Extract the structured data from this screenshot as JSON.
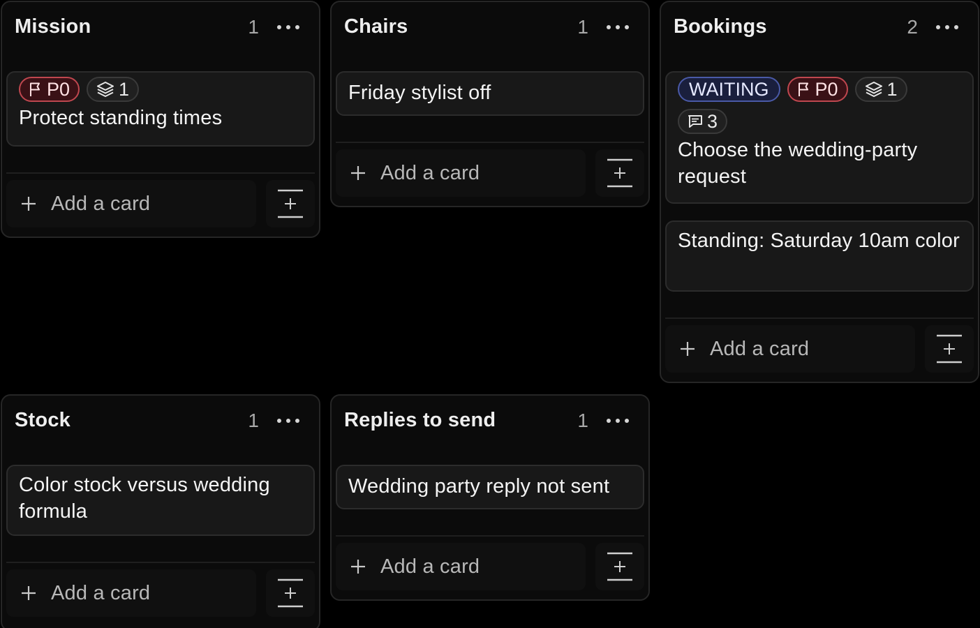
{
  "columns": [
    {
      "title": "Mission",
      "count": "1",
      "cards": [
        {
          "chips": [
            {
              "kind": "priority",
              "icon": "flag-icon",
              "text": "P0"
            },
            {
              "kind": "subtasks",
              "icon": "layers-icon",
              "text": "1"
            }
          ],
          "title": "Protect standing times"
        }
      ],
      "add_label": "Add a card"
    },
    {
      "title": "Chairs",
      "count": "1",
      "cards": [
        {
          "chips": [],
          "title": "Friday stylist off"
        }
      ],
      "add_label": "Add a card"
    },
    {
      "title": "Bookings",
      "count": "2",
      "cards": [
        {
          "chips": [
            {
              "kind": "status",
              "icon": "",
              "text": "WAITING"
            },
            {
              "kind": "priority",
              "icon": "flag-icon",
              "text": "P0"
            },
            {
              "kind": "subtasks",
              "icon": "layers-icon",
              "text": "1"
            },
            {
              "kind": "comments",
              "icon": "comment-icon",
              "text": "3"
            }
          ],
          "title": "Choose the wedding-party request"
        },
        {
          "chips": [],
          "title": "Standing: Saturday 10am color"
        }
      ],
      "add_label": "Add a card"
    },
    {
      "title": "Stock",
      "count": "1",
      "cards": [
        {
          "chips": [],
          "title": "Color stock versus wedding formula"
        }
      ],
      "add_label": "Add a card"
    },
    {
      "title": "Replies to send",
      "count": "1",
      "cards": [
        {
          "chips": [],
          "title": "Wedding party reply not sent"
        }
      ],
      "add_label": "Add a card"
    }
  ],
  "icons": {
    "more": "more-horizontal-icon",
    "add": "plus-icon",
    "template": "add-from-template-icon"
  },
  "colors": {
    "background": "#000000",
    "column": "#0b0b0b",
    "card": "#181818",
    "priority": "#c0474f",
    "status": "#4a5aa8"
  }
}
